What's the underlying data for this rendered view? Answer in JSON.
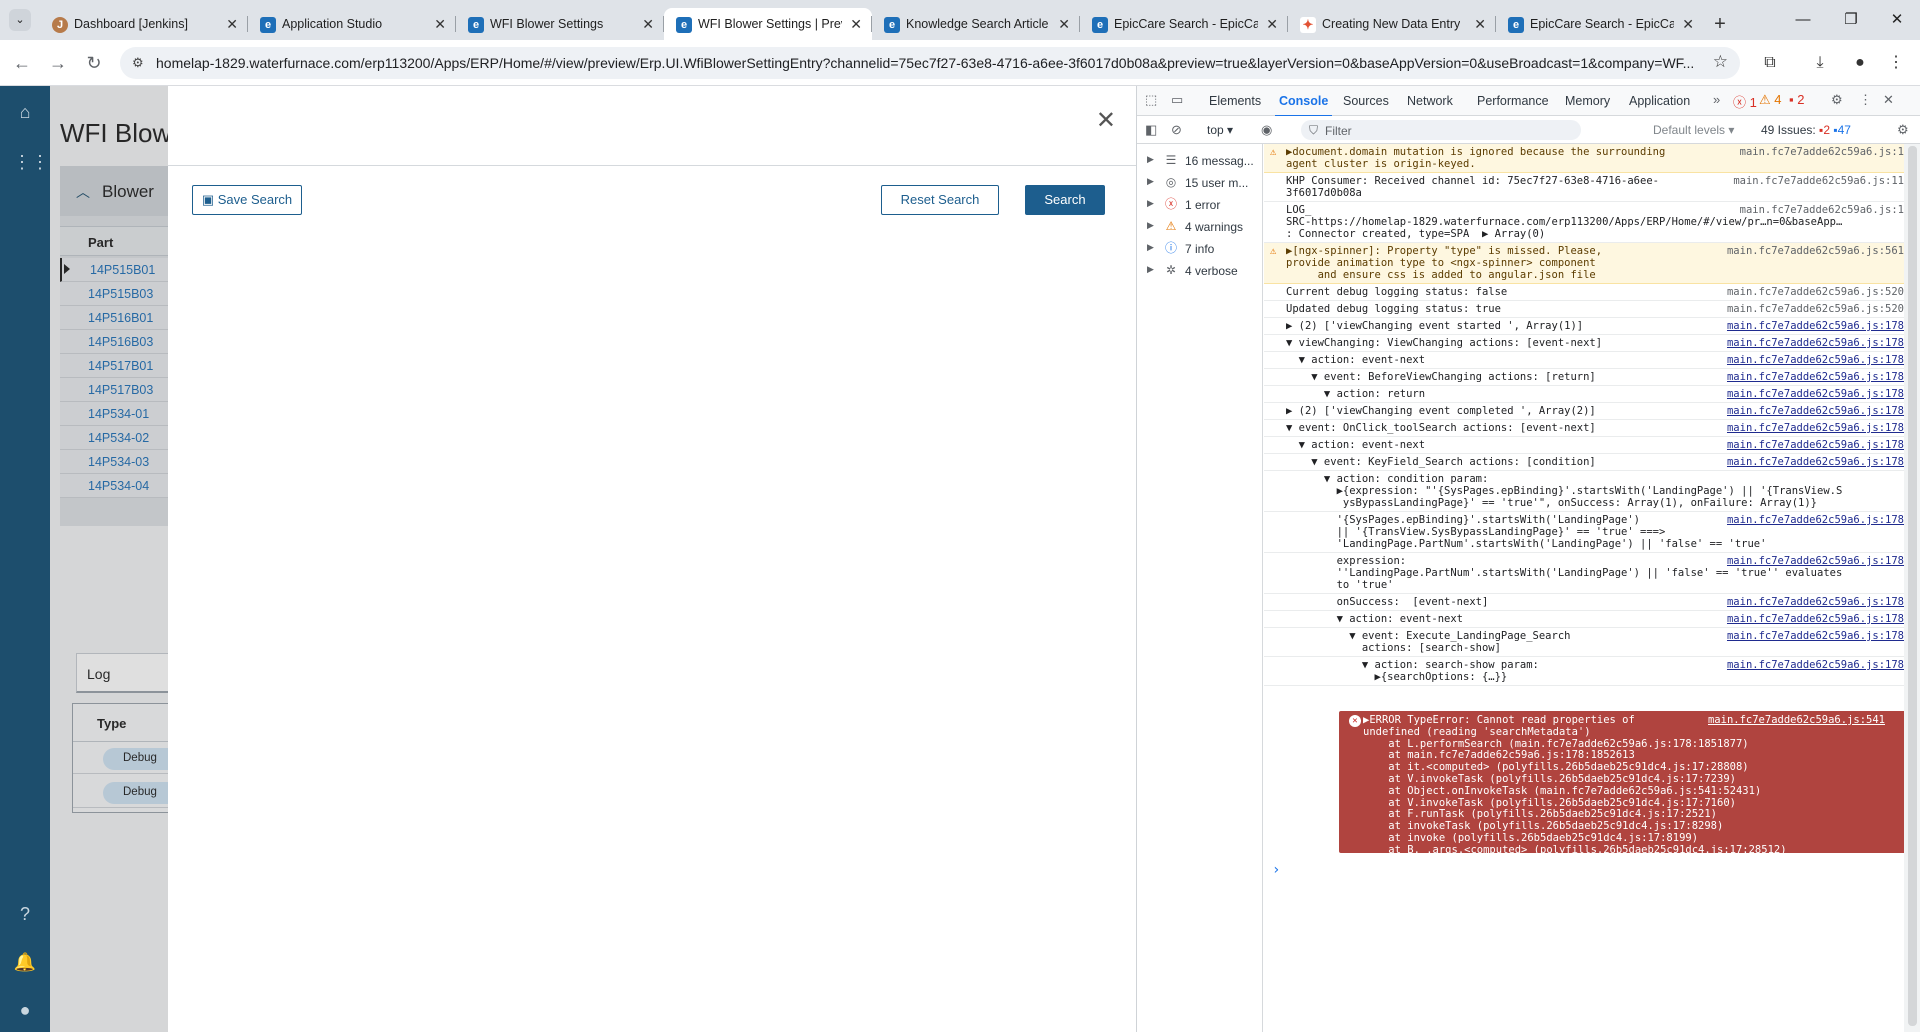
{
  "browser": {
    "tabs": [
      {
        "title": "Dashboard [Jenkins]",
        "icon": "jenkins-icon"
      },
      {
        "title": "Application Studio",
        "icon": "epicor-icon"
      },
      {
        "title": "WFI Blower Settings",
        "icon": "epicor-icon"
      },
      {
        "title": "WFI Blower Settings | Prev",
        "icon": "epicor-icon",
        "active": true
      },
      {
        "title": "Knowledge Search Article",
        "icon": "epicor-icon"
      },
      {
        "title": "EpicCare Search - EpicCar",
        "icon": "epicor-icon"
      },
      {
        "title": "Creating New Data Entry",
        "icon": "figma-icon"
      },
      {
        "title": "EpicCare Search - EpicCar",
        "icon": "epicor-icon"
      }
    ],
    "url": "homelap-1829.waterfurnace.com/erp113200/Apps/ERP/Home/#/view/preview/Erp.UI.WfiBlowerSettingEntry?channelid=75ec7f27-63e8-4716-a6ee-3f6017d0b08a&preview=true&layerVersion=0&baseAppVersion=0&useBroadcast=1&company=WF..."
  },
  "app": {
    "page_title": "WFI Blow",
    "card_title": "Blower",
    "part_header": "Part",
    "parts": [
      "14P515B01",
      "14P515B03",
      "14P516B01",
      "14P516B03",
      "14P517B01",
      "14P517B03",
      "14P534-01",
      "14P534-02",
      "14P534-03",
      "14P534-04"
    ],
    "log_tab": "Log",
    "log_type_header": "Type",
    "log_rows": [
      "Debug",
      "Debug"
    ]
  },
  "modal": {
    "save_search": "Save Search",
    "reset_search": "Reset Search",
    "search": "Search"
  },
  "devtools": {
    "tabs": [
      "Elements",
      "Console",
      "Sources",
      "Network",
      "Performance",
      "Memory",
      "Application"
    ],
    "active_tab": "Console",
    "badges": {
      "errors": "1",
      "warnings": "4",
      "issues": "2"
    },
    "context": "top",
    "filter_placeholder": "Filter",
    "levels": "Default levels",
    "issues_label": "49 Issues:",
    "issues_err": "2",
    "issues_info": "47",
    "sidebar": [
      {
        "label": "16 messag...",
        "icon": "list-icon"
      },
      {
        "label": "15 user m...",
        "icon": "user-icon"
      },
      {
        "label": "1 error",
        "icon": "error-icon"
      },
      {
        "label": "4 warnings",
        "icon": "warning-icon"
      },
      {
        "label": "7 info",
        "icon": "info-icon"
      },
      {
        "label": "4 verbose",
        "icon": "bug-icon"
      }
    ],
    "console": [
      {
        "type": "warn",
        "text": "▶document.domain mutation is ignored because the surrounding\nagent cluster is origin-keyed.",
        "src": "main.fc7e7adde62c59a6.js:1"
      },
      {
        "type": "log",
        "text": "KHP Consumer: Received channel id: 75ec7f27-63e8-4716-a6ee-\n3f6017d0b08a",
        "src": "main.fc7e7adde62c59a6.js:11"
      },
      {
        "type": "log",
        "text": "LOG_\nSRC-https://homelap-1829.waterfurnace.com/erp113200/Apps/ERP/Home/#/view/pr…n=0&baseApp…\n: Connector created, type=SPA  ▶ Array(0)",
        "src": "main.fc7e7adde62c59a6.js:1"
      },
      {
        "type": "warn",
        "text": "▶[ngx-spinner]: Property \"type\" is missed. Please,\nprovide animation type to <ngx-spinner> component\n     and ensure css is added to angular.json file",
        "src": "main.fc7e7adde62c59a6.js:561"
      },
      {
        "type": "log",
        "text": "Current debug logging status: false",
        "src": "main.fc7e7adde62c59a6.js:520"
      },
      {
        "type": "log",
        "text": "Updated debug logging status: true",
        "src": "main.fc7e7adde62c59a6.js:520"
      },
      {
        "type": "log",
        "text": "▶ (2) ['viewChanging event started ', Array(1)]",
        "src": "main.fc7e7adde62c59a6.js:178"
      },
      {
        "type": "log",
        "text": "▼ viewChanging: ViewChanging actions: [event-next]",
        "src": "main.fc7e7adde62c59a6.js:178"
      },
      {
        "type": "log",
        "text": "  ▼ action: event-next",
        "src": "main.fc7e7adde62c59a6.js:178"
      },
      {
        "type": "log",
        "text": "    ▼ event: BeforeViewChanging actions: [return]",
        "src": "main.fc7e7adde62c59a6.js:178"
      },
      {
        "type": "log",
        "text": "      ▼ action: return",
        "src": "main.fc7e7adde62c59a6.js:178"
      },
      {
        "type": "log",
        "text": "▶ (2) ['viewChanging event completed ', Array(2)]",
        "src": "main.fc7e7adde62c59a6.js:178"
      },
      {
        "type": "log",
        "text": "▼ event: OnClick_toolSearch actions: [event-next]",
        "src": "main.fc7e7adde62c59a6.js:178"
      },
      {
        "type": "log",
        "text": "  ▼ action: event-next",
        "src": "main.fc7e7adde62c59a6.js:178"
      },
      {
        "type": "log",
        "text": "    ▼ event: KeyField_Search actions: [condition]",
        "src": "main.fc7e7adde62c59a6.js:178"
      },
      {
        "type": "log",
        "text": "      ▼ action: condition param:\n        ▶{expression: \"'{SysPages.epBinding}'.startsWith('LandingPage') || '{TransView.S\n         ysBypassLandingPage}' == 'true'\", onSuccess: Array(1), onFailure: Array(1)}",
        "src": ""
      },
      {
        "type": "log",
        "text": "        '{SysPages.epBinding}'.startsWith('LandingPage')\n        || '{TransView.SysBypassLandingPage}' == 'true' ===>\n        'LandingPage.PartNum'.startsWith('LandingPage') || 'false' == 'true'",
        "src": "main.fc7e7adde62c59a6.js:178"
      },
      {
        "type": "log",
        "text": "        expression:\n        ''LandingPage.PartNum'.startsWith('LandingPage') || 'false' == 'true'' evaluates\n        to 'true'",
        "src": "main.fc7e7adde62c59a6.js:178"
      },
      {
        "type": "log",
        "text": "        onSuccess:  [event-next]",
        "src": "main.fc7e7adde62c59a6.js:178"
      },
      {
        "type": "log",
        "text": "        ▼ action: event-next",
        "src": "main.fc7e7adde62c59a6.js:178"
      },
      {
        "type": "log",
        "text": "          ▼ event: Execute_LandingPage_Search\n            actions: [search-show]",
        "src": "main.fc7e7adde62c59a6.js:178"
      },
      {
        "type": "log",
        "text": "            ▼ action: search-show param:\n              ▶{searchOptions: {…}}",
        "src": "main.fc7e7adde62c59a6.js:178"
      }
    ],
    "error": {
      "src": "main.fc7e7adde62c59a6.js:541",
      "lines": [
        "▶ERROR TypeError: Cannot read properties of",
        "undefined (reading 'searchMetadata')",
        "    at L.performSearch (main.fc7e7adde62c59a6.js:178:1851877)",
        "    at main.fc7e7adde62c59a6.js:178:1852613",
        "    at it.<computed> (polyfills.26b5daeb25c91dc4.js:17:28808)",
        "    at V.invokeTask (polyfills.26b5daeb25c91dc4.js:17:7239)",
        "    at Object.onInvokeTask (main.fc7e7adde62c59a6.js:541:52431)",
        "    at V.invokeTask (polyfills.26b5daeb25c91dc4.js:17:7160)",
        "    at F.runTask (polyfills.26b5daeb25c91dc4.js:17:2521)",
        "    at invokeTask (polyfills.26b5daeb25c91dc4.js:17:8298)",
        "    at invoke (polyfills.26b5daeb25c91dc4.js:17:8199)",
        "    at B._.args.<computed> (polyfills.26b5daeb25c91dc4.js:17:28512)"
      ]
    },
    "prompt": "›"
  }
}
